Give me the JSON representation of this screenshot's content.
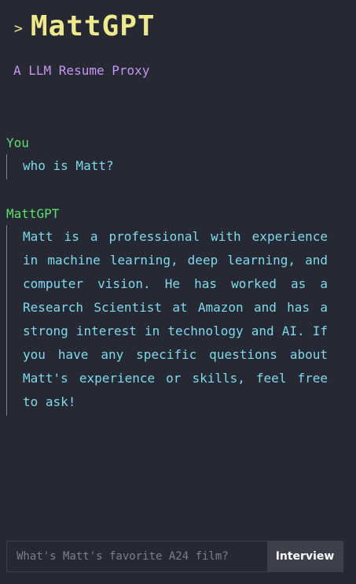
{
  "header": {
    "caret": ">",
    "title": "MattGPT",
    "subtitle": "A LLM Resume Proxy"
  },
  "conversation": [
    {
      "speaker": "You",
      "text": "who is Matt?"
    },
    {
      "speaker": "MattGPT",
      "text": "Matt is a professional with experience in machine learning, deep learning, and computer vision. He has worked as a Research Scientist at Amazon and has a strong interest in technology and AI. If you have any specific questions about Matt's experience or skills, feel free to ask!"
    }
  ],
  "input": {
    "placeholder": "What's Matt's favorite A24 film?",
    "value": "",
    "submit_label": "Interview"
  },
  "colors": {
    "background": "#262833",
    "title": "#efe98d",
    "subtitle": "#c597f2",
    "speaker": "#59e26a",
    "message": "#7fd9ec"
  }
}
